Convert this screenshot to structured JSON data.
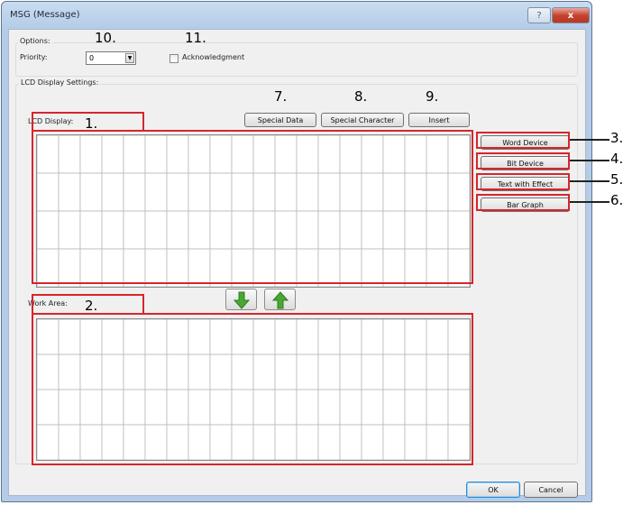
{
  "window": {
    "title": "MSG (Message)",
    "help_label": "?",
    "close_label": "x"
  },
  "options": {
    "group_label": "Options:",
    "priority_label": "Priority:",
    "priority_value": "0",
    "acknowledgment_label": "Acknowledgment"
  },
  "lcd_settings": {
    "group_label": "LCD Display Settings:"
  },
  "toolbar": {
    "special_data_label": "Special Data",
    "special_character_label": "Special Character",
    "insert_label": "Insert"
  },
  "lcd_display": {
    "label": "LCD Display:",
    "rows": 4,
    "columns": 20
  },
  "work_area": {
    "label": "Work Area:",
    "rows": 4,
    "columns": 20
  },
  "side_buttons": {
    "word_device_label": "Word Device",
    "bit_device_label": "Bit Device",
    "text_with_effect_label": "Text with Effect",
    "bar_graph_label": "Bar Graph"
  },
  "move_buttons": {
    "down_icon": "green-down-arrow-icon",
    "up_icon": "green-up-arrow-icon"
  },
  "footer": {
    "ok_label": "OK",
    "cancel_label": "Cancel"
  },
  "callouts": {
    "n1": "1.",
    "n2": "2.",
    "n3": "3.",
    "n4": "4.",
    "n5": "5.",
    "n6": "6.",
    "n7": "7.",
    "n8": "8.",
    "n9": "9.",
    "n10": "10.",
    "n11": "11."
  },
  "colors": {
    "callout_box": "#d6262b",
    "arrow_green": "#4aa832"
  }
}
